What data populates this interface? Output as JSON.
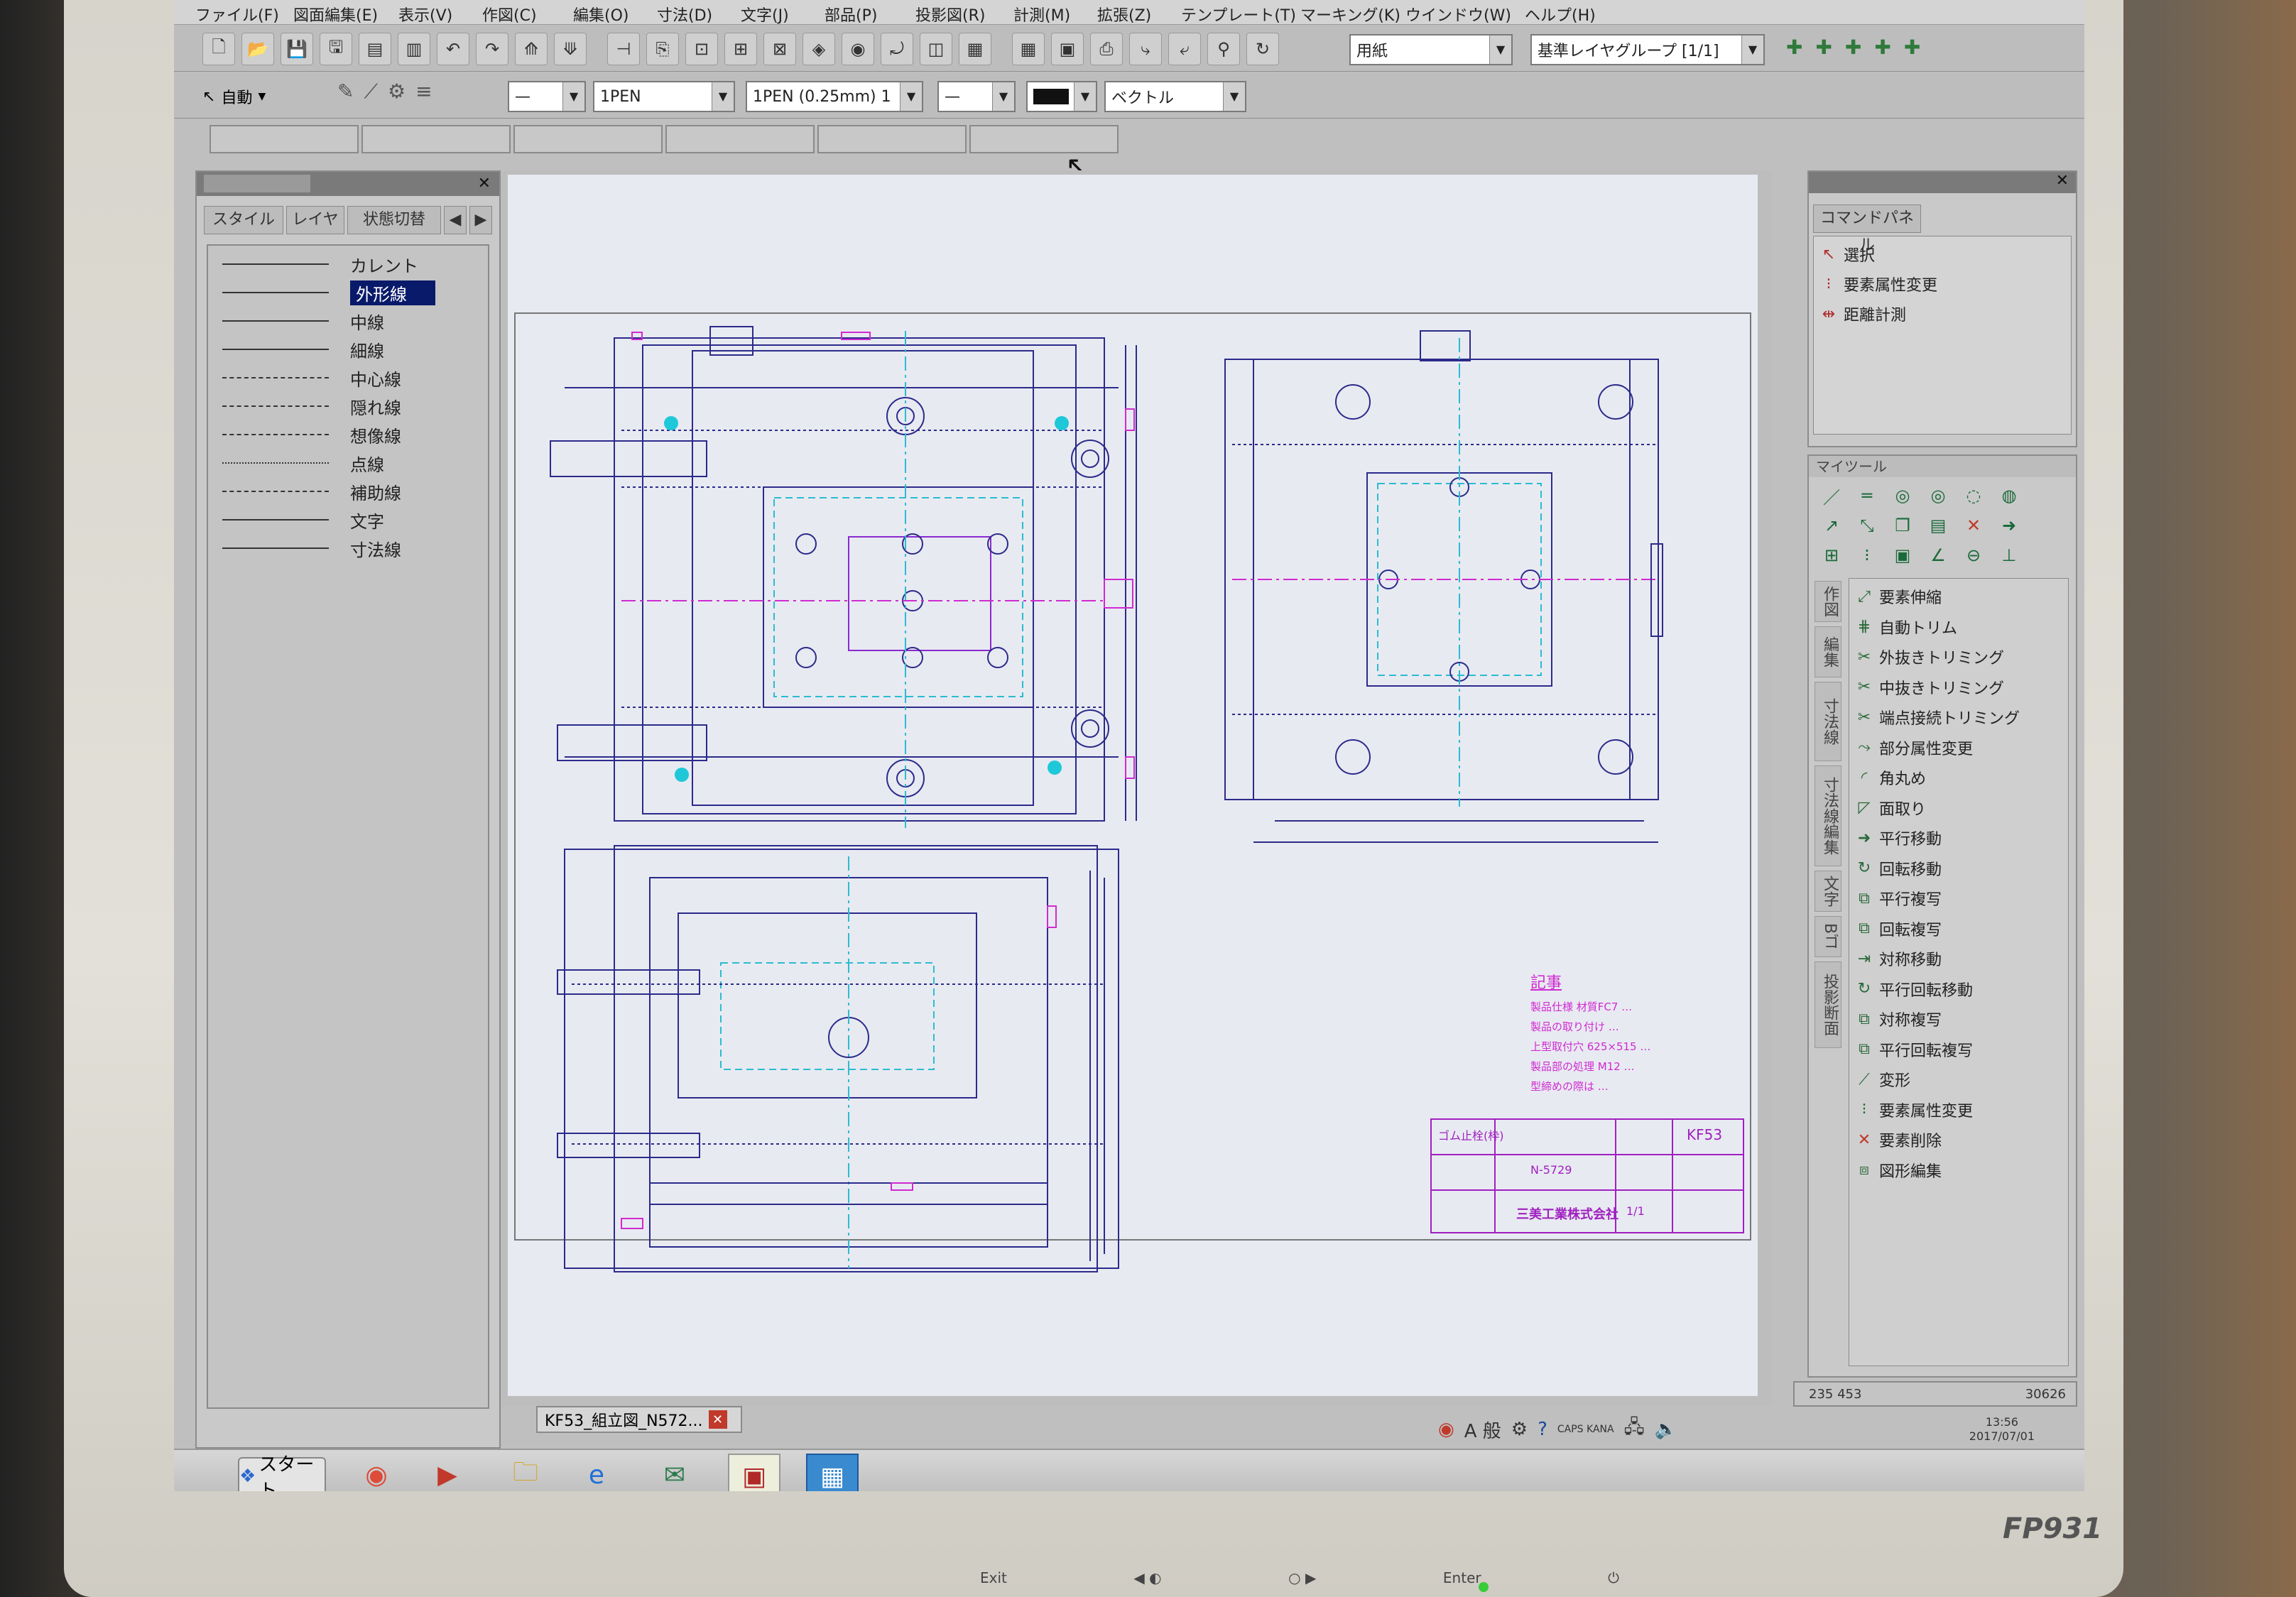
{
  "menubar": {
    "items": [
      "ファイル(F)",
      "図面編集(E)",
      "表示(V)",
      "作図(C)",
      "編集(O)",
      "寸法(D)",
      "文字(J)",
      "部品(P)",
      "投影図(R)",
      "計測(M)",
      "拡張(Z)",
      "テンプレート(T)",
      "マーキング(K)",
      "ウインドウ(W)",
      "ヘルプ(H)"
    ]
  },
  "toolbar2": {
    "mode_label": "自動",
    "combo_sheet": "用紙",
    "combo_layer_group": "基準レイヤグループ [1/1]",
    "combo_pen": "1PEN",
    "combo_pen_width": "1PEN (0.25mm) 1",
    "combo_type": "ベクトル"
  },
  "style_panel": {
    "tabs": [
      "スタイル",
      "レイヤ",
      "状態切替"
    ],
    "items": [
      {
        "label": "カレント",
        "dash": "solid",
        "selected": false
      },
      {
        "label": "外形線",
        "dash": "solid",
        "selected": true
      },
      {
        "label": "中線",
        "dash": "solid",
        "selected": false
      },
      {
        "label": "細線",
        "dash": "solid",
        "selected": false
      },
      {
        "label": "中心線",
        "dash": "dashdot",
        "selected": false
      },
      {
        "label": "隠れ線",
        "dash": "dashed",
        "selected": false
      },
      {
        "label": "想像線",
        "dash": "dashdotdot",
        "selected": false
      },
      {
        "label": "点線",
        "dash": "dotted",
        "selected": false
      },
      {
        "label": "補助線",
        "dash": "dashdot",
        "selected": false
      },
      {
        "label": "文字",
        "dash": "solid",
        "selected": false
      },
      {
        "label": "寸法線",
        "dash": "arrow",
        "selected": false
      }
    ]
  },
  "command_panel": {
    "tab": "コマンドパネル",
    "items": [
      {
        "label": "選択",
        "icon": "select-arrow-icon"
      },
      {
        "label": "要素属性変更",
        "icon": "attribute-icon"
      },
      {
        "label": "距離計測",
        "icon": "measure-icon"
      }
    ]
  },
  "mytool": {
    "title": "マイツール",
    "vertical_tabs": [
      "作図",
      "編集",
      "寸法線",
      "寸法線編集",
      "文字",
      "Bゴ",
      "投影断面"
    ],
    "items": [
      "要素伸縮",
      "自動トリム",
      "外抜きトリミング",
      "中抜きトリミング",
      "端点接続トリミング",
      "部分属性変更",
      "角丸め",
      "面取り",
      "平行移動",
      "回転移動",
      "平行複写",
      "回転複写",
      "対称移動",
      "平行回転移動",
      "対称複写",
      "平行回転複写",
      "変形",
      "要素属性変更",
      "要素削除",
      "図形編集"
    ]
  },
  "document": {
    "tab_label": "KF53_組立図_N572...",
    "notes_title": "記事",
    "notes": [
      "製品仕様 材質FC7 …",
      "製品の取り付け …",
      "上型取付穴 625×515 …",
      "製品部の処理 M12 …",
      "型締めの際は …"
    ],
    "title_block": {
      "part_name": "ゴム止栓(枠)",
      "code": "KF53",
      "drawing_no": "N-5729",
      "company": "三美工業株式会社",
      "scale": "1/1"
    }
  },
  "statusbar": {
    "coords": "235    453",
    "extra": "30626"
  },
  "taskbar": {
    "start_label": "スタート",
    "ime": "A 般",
    "caps": "CAPS KANA",
    "clock_time": "13:56",
    "clock_date": "2017/07/01"
  },
  "monitor": {
    "brand": "FP931",
    "buttons": [
      "Exit",
      "◀ ◐",
      "○ ▶",
      "Enter",
      "⏻"
    ]
  },
  "colors": {
    "drawing_line": "#2b2b8a",
    "cyan": "#1fc8d8",
    "magenta": "#d02ad0",
    "canvas": "#e8eaf2"
  }
}
